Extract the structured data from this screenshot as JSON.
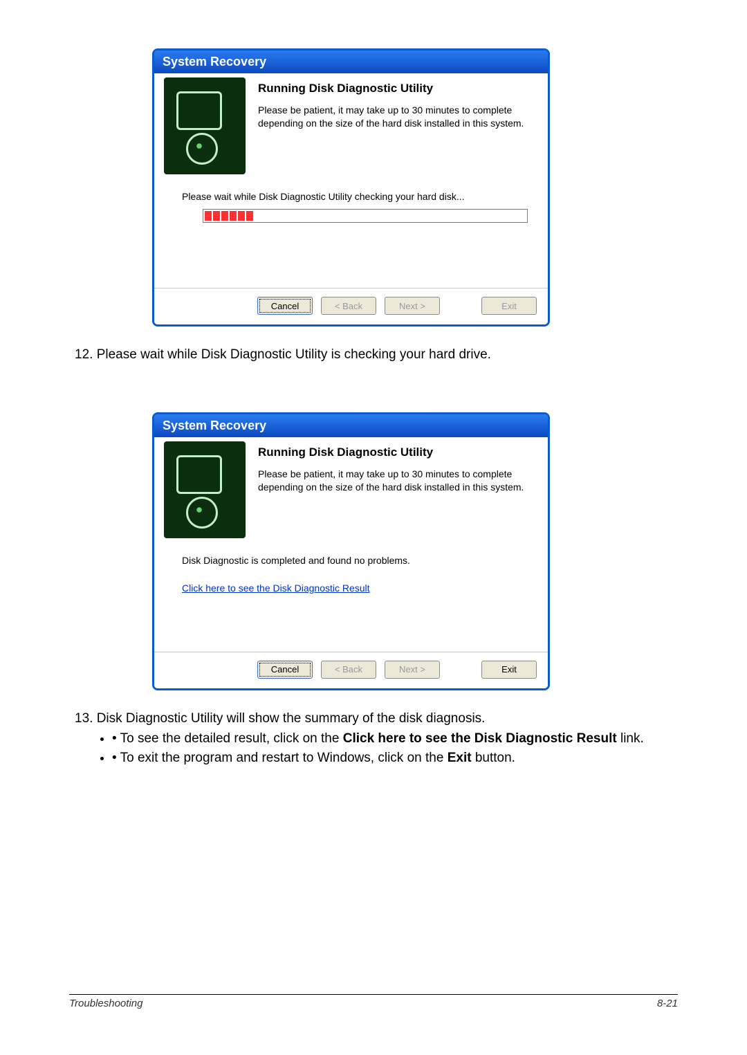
{
  "dialog1": {
    "title": "System Recovery",
    "heading": "Running Disk Diagnostic Utility",
    "desc": "Please be patient, it may take up to 30 minutes to complete depending on the size of the hard disk installed in this system.",
    "status": "Please wait while Disk Diagnostic Utility checking your hard disk...",
    "progress_blocks": 6,
    "buttons": {
      "cancel": "Cancel",
      "back": "< Back",
      "next": "Next >",
      "exit": "Exit"
    }
  },
  "step12": "12. Please wait while Disk Diagnostic Utility is checking your hard drive.",
  "dialog2": {
    "title": "System Recovery",
    "heading": "Running Disk Diagnostic Utility",
    "desc": "Please be patient, it may take up to 30 minutes to complete depending on the size of the hard disk installed in this system.",
    "status": "Disk Diagnostic is completed and found no problems.",
    "link": "Click here to see the Disk Diagnostic Result",
    "buttons": {
      "cancel": "Cancel",
      "back": "< Back",
      "next": "Next >",
      "exit": "Exit"
    }
  },
  "step13": {
    "main": "13. Disk Diagnostic Utility will show the summary of the disk diagnosis.",
    "b1_pre": "To see the detailed result, click on the ",
    "b1_bold": "Click here to see the Disk Diagnostic Result",
    "b1_post": " link.",
    "b2_pre": "To exit the program and restart to Windows, click on the ",
    "b2_bold": "Exit",
    "b2_post": " button."
  },
  "footer": {
    "left": "Troubleshooting",
    "right": "8-21"
  }
}
